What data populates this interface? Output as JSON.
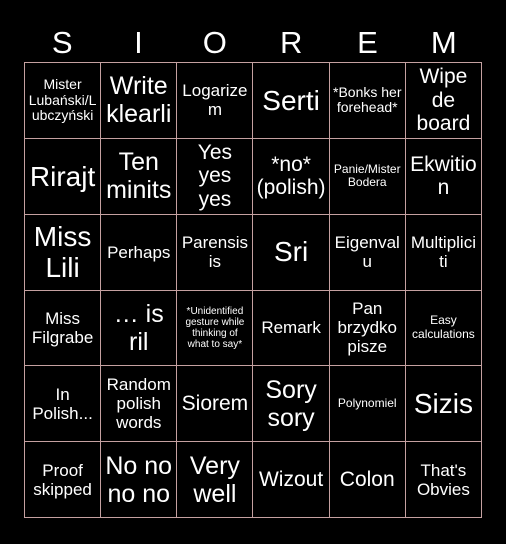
{
  "card": {
    "background_color": "#000000",
    "text_color": "#ffffff",
    "border_color": "#c5a1a1",
    "header": {
      "letters": [
        "S",
        "I",
        "O",
        "R",
        "E",
        "M"
      ]
    },
    "grid": {
      "rows": 6,
      "columns": 6,
      "cells": [
        {
          "text": "Mister Lubański/Lubczyński",
          "size": "fs-s"
        },
        {
          "text": "Write klearli",
          "size": "fs-xl"
        },
        {
          "text": "Logarizem",
          "size": "fs-m"
        },
        {
          "text": "Serti",
          "size": "fs-xxl"
        },
        {
          "text": "*Bonks her forehead*",
          "size": "fs-s"
        },
        {
          "text": "Wipe de board",
          "size": "fs-l"
        },
        {
          "text": "Rirajt",
          "size": "fs-xxl"
        },
        {
          "text": "Ten minits",
          "size": "fs-xl"
        },
        {
          "text": "Yes yes yes",
          "size": "fs-l"
        },
        {
          "text": "*no* (polish)",
          "size": "fs-l"
        },
        {
          "text": "Panie/Mister Bodera",
          "size": "fs-xs"
        },
        {
          "text": "Ekwition",
          "size": "fs-l"
        },
        {
          "text": "Miss Lili",
          "size": "fs-xxl"
        },
        {
          "text": "Perhaps",
          "size": "fs-m"
        },
        {
          "text": "Parensisis",
          "size": "fs-m"
        },
        {
          "text": "Sri",
          "size": "fs-xxl"
        },
        {
          "text": "Eigenvalu",
          "size": "fs-m"
        },
        {
          "text": "Multipliciti",
          "size": "fs-m"
        },
        {
          "text": "Miss Filgrabe",
          "size": "fs-m"
        },
        {
          "text": "… is ril",
          "size": "fs-xl"
        },
        {
          "text": "*Unidentified gesture while thinking of what to say*",
          "size": "fs-xxs"
        },
        {
          "text": "Remark",
          "size": "fs-m"
        },
        {
          "text": "Pan brzydko pisze",
          "size": "fs-m"
        },
        {
          "text": "Easy calculations",
          "size": "fs-xs"
        },
        {
          "text": "In Polish...",
          "size": "fs-m"
        },
        {
          "text": "Random polish words",
          "size": "fs-m"
        },
        {
          "text": "Siorem",
          "size": "fs-l"
        },
        {
          "text": "Sory sory",
          "size": "fs-xl"
        },
        {
          "text": "Polynomiel",
          "size": "fs-xs"
        },
        {
          "text": "Sizis",
          "size": "fs-xxl"
        },
        {
          "text": "Proof skipped",
          "size": "fs-m"
        },
        {
          "text": "No no no no",
          "size": "fs-xl"
        },
        {
          "text": "Very well",
          "size": "fs-xl"
        },
        {
          "text": "Wizout",
          "size": "fs-l"
        },
        {
          "text": "Colon",
          "size": "fs-l"
        },
        {
          "text": "That's Obvies",
          "size": "fs-m"
        }
      ]
    }
  }
}
